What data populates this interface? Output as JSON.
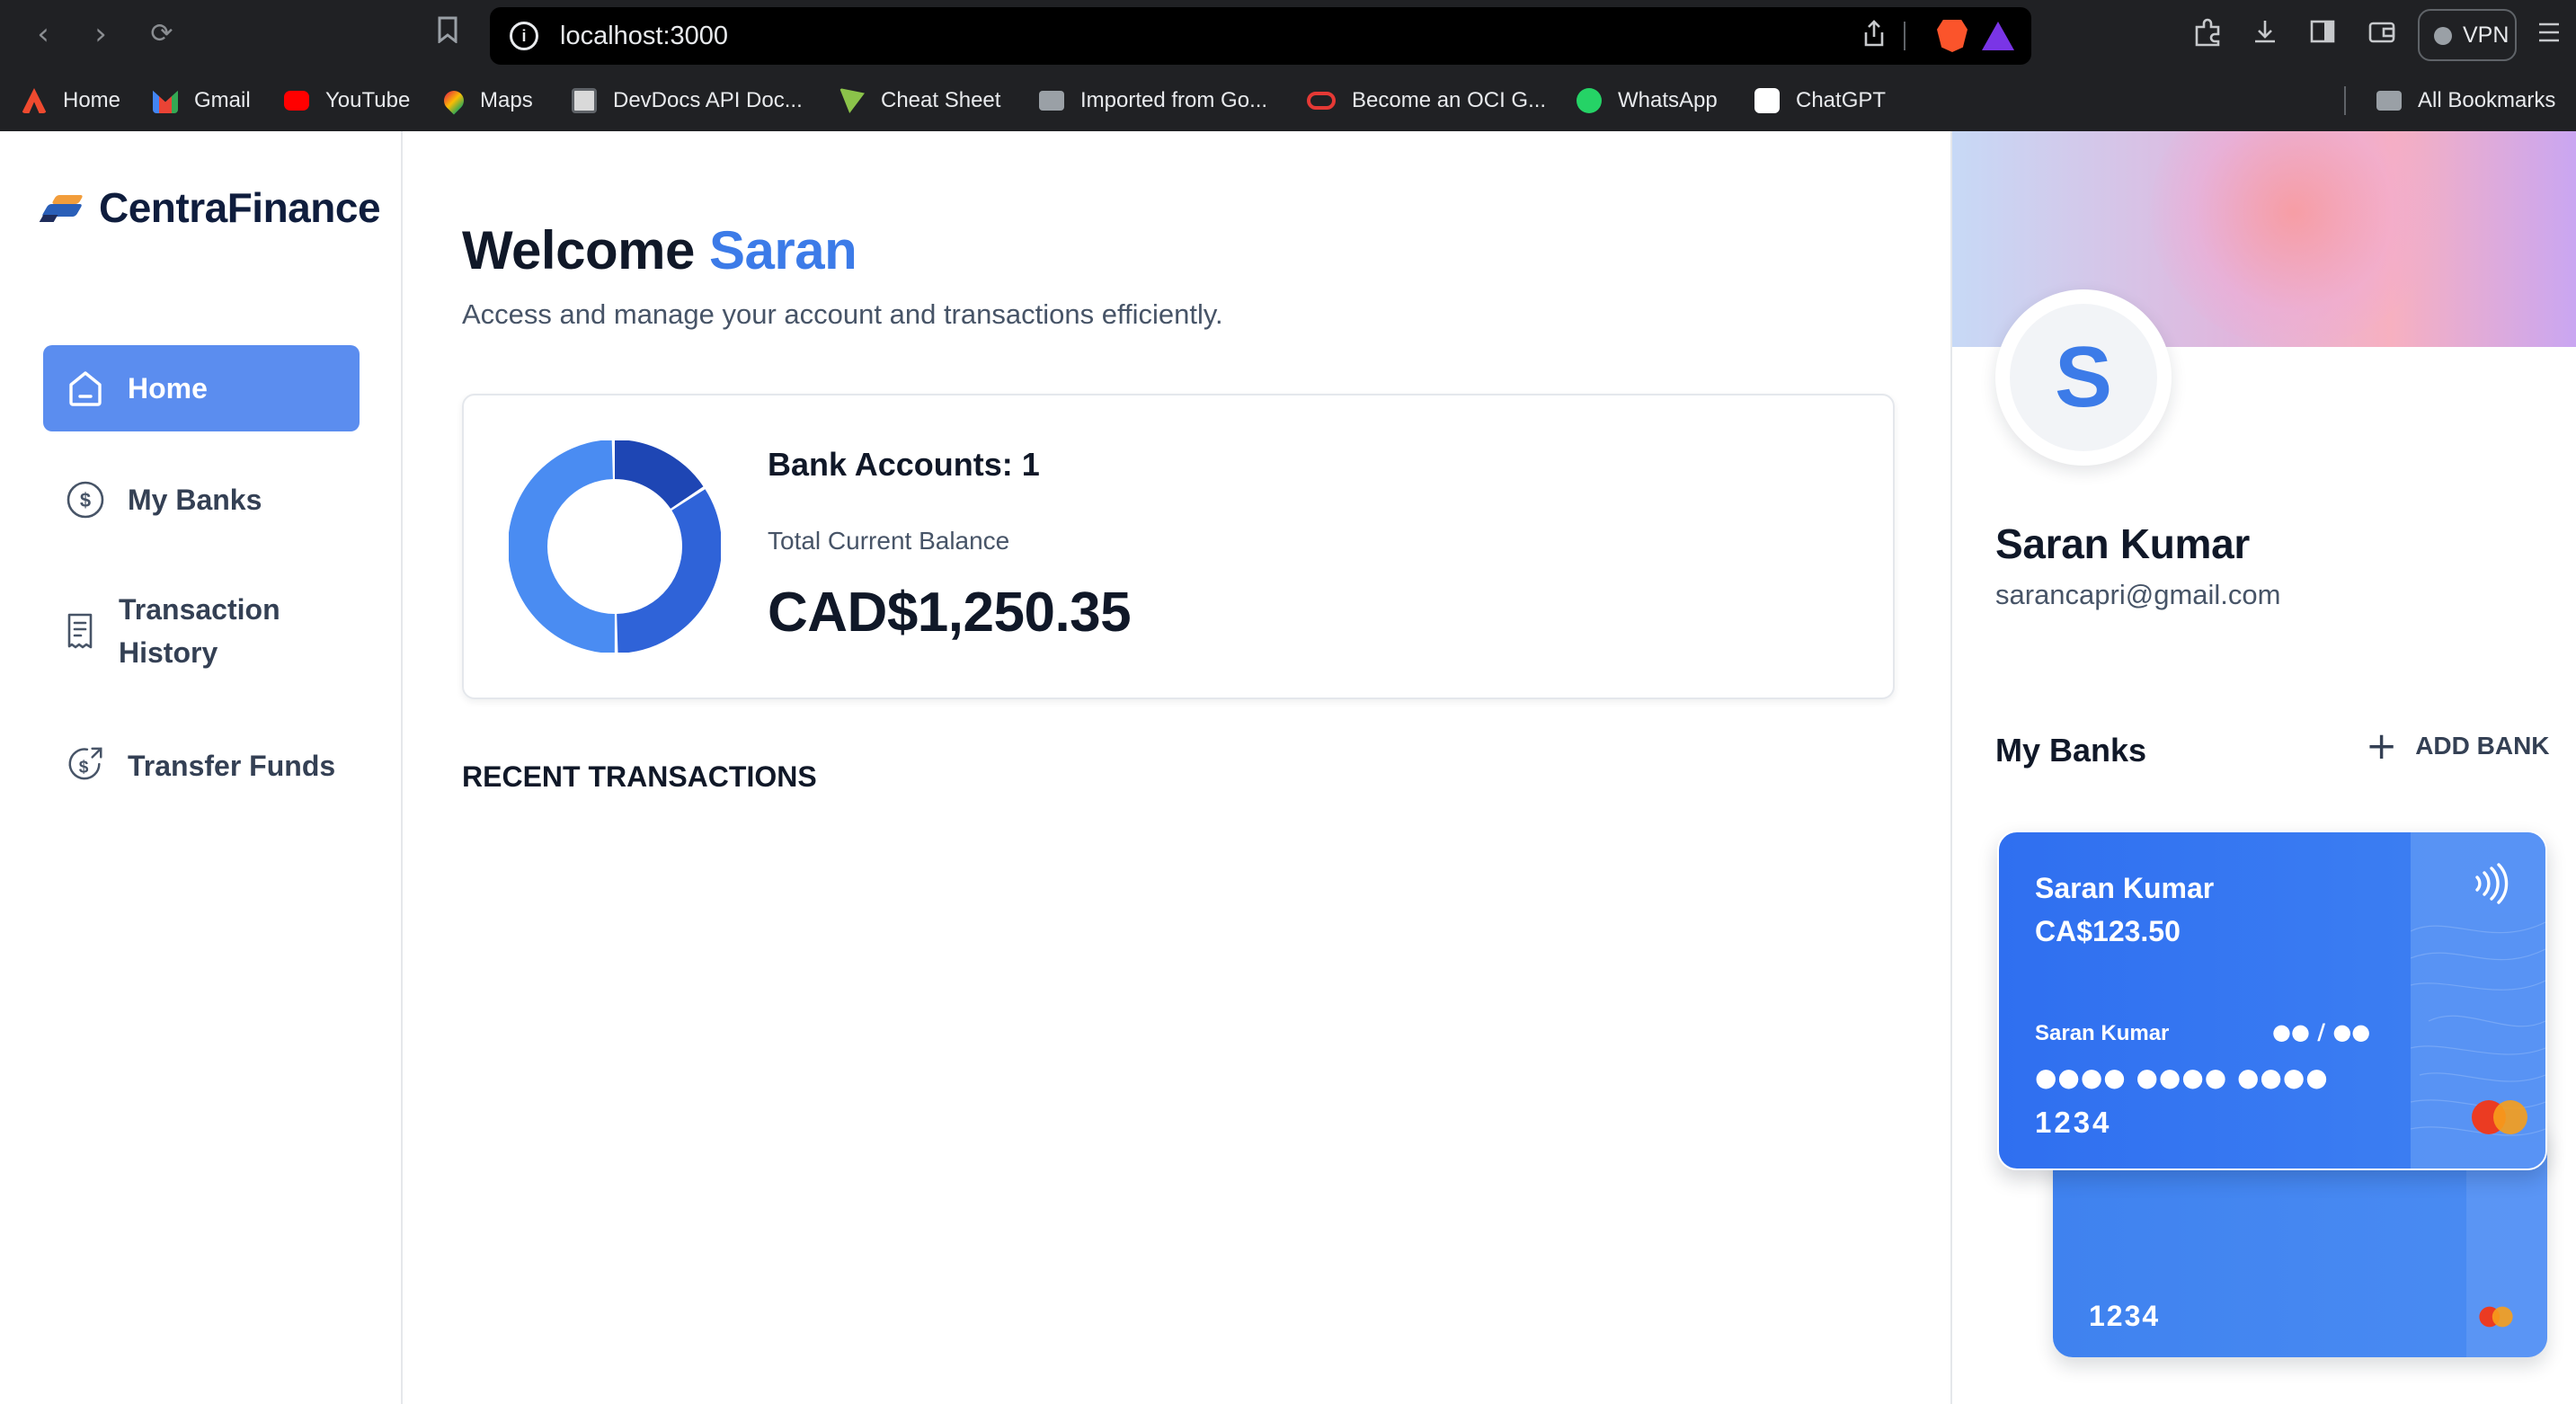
{
  "browser": {
    "url": "localhost:3000",
    "vpn_label": "VPN",
    "nav": {
      "back_icon": "chevron-left-icon",
      "forward_icon": "chevron-right-icon",
      "reload_icon": "reload-icon"
    }
  },
  "bookmarks": {
    "items": [
      {
        "label": "Home",
        "color": "#f04a2f"
      },
      {
        "label": "Gmail",
        "color": "#ea4335"
      },
      {
        "label": "YouTube",
        "color": "#ff0000"
      },
      {
        "label": "Maps",
        "color": "#34a853"
      },
      {
        "label": "DevDocs API Doc...",
        "color": "#d9d9d9"
      },
      {
        "label": "Cheat Sheet",
        "color": "#8bc34a"
      },
      {
        "label": "Imported from Go...",
        "color": "#9aa0a6"
      },
      {
        "label": "Become an OCI G...",
        "color": "#e53935"
      },
      {
        "label": "WhatsApp",
        "color": "#25d366"
      },
      {
        "label": "ChatGPT",
        "color": "#ffffff"
      }
    ],
    "all_bookmarks": "All Bookmarks"
  },
  "sidebar": {
    "brand": "CentraFinance",
    "items": [
      {
        "label": "Home",
        "icon": "home-icon",
        "active": true
      },
      {
        "label": "My Banks",
        "icon": "dollar-circle-icon",
        "active": false
      },
      {
        "label": "Transaction History",
        "icon": "receipt-icon",
        "active": false
      },
      {
        "label": "Transfer Funds",
        "icon": "money-send-icon",
        "active": false
      }
    ]
  },
  "main": {
    "welcome_prefix": "Welcome",
    "welcome_name": "Saran",
    "subtitle": "Access and manage your account and transactions efficiently.",
    "bank_accounts_label": "Bank Accounts: 1",
    "total_label": "Total Current Balance",
    "total_value": "CAD$1,250.35",
    "recent_title": "RECENT TRANSACTIONS"
  },
  "donut": {
    "segments": [
      {
        "value": 0.16,
        "color": "#1e46b4"
      },
      {
        "value": 0.34,
        "color": "#2f63d8"
      },
      {
        "value": 0.5,
        "color": "#4a8cf2"
      }
    ]
  },
  "profile": {
    "initial": "S",
    "name": "Saran Kumar",
    "email": "sarancapri@gmail.com",
    "my_banks_title": "My Banks",
    "add_bank_label": "ADD BANK"
  },
  "card": {
    "holder": "Saran Kumar",
    "balance": "CA$123.50",
    "name_small": "Saran Kumar",
    "expiry": "●● / ●●",
    "number_masked": "●●●● ●●●● ●●●●",
    "last4": "1234",
    "back_last4": "1234"
  },
  "colors": {
    "accent": "#3c7be8",
    "active_nav": "#5b8def"
  }
}
